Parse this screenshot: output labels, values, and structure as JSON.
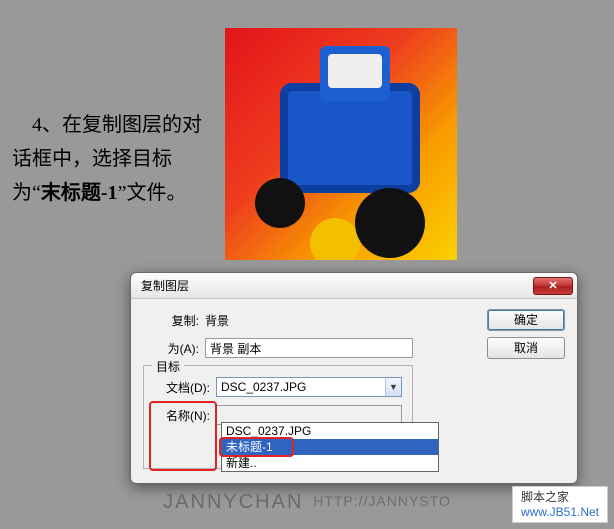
{
  "instruction": {
    "text_before": "　4、在复制图层的对话框中，选择目标为“",
    "em": "末标题-1",
    "text_after": "”文件。"
  },
  "dialog": {
    "title": "复制图层",
    "close_glyph": "✕",
    "copy_label": "复制:",
    "copy_value": "背景",
    "as_label": "为(A):",
    "as_value": "背景 副本",
    "target_legend": "目标",
    "doc_label": "文档(D):",
    "doc_value": "DSC_0237.JPG",
    "name_label": "名称(N):",
    "dropdown": {
      "options": [
        "DSC_0237.JPG",
        "未标题-1",
        "新建.."
      ],
      "selected_index": 1
    },
    "ok_label": "确定",
    "cancel_label": "取消"
  },
  "footer": {
    "brand": "JANNYCHAN",
    "url": "HTTP://JANNYSTO"
  },
  "corner": {
    "cn": "脚本之家",
    "url": "www.JB51.Net"
  }
}
